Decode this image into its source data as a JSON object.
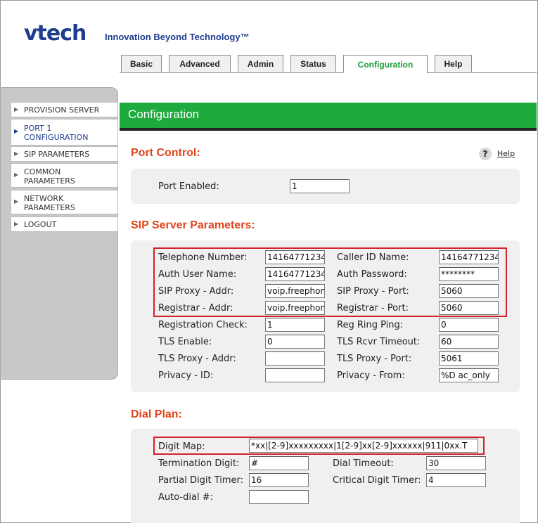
{
  "brand": {
    "logo": "vtech",
    "tagline": "Innovation Beyond Technology™"
  },
  "tabs": [
    {
      "label": "Basic"
    },
    {
      "label": "Advanced"
    },
    {
      "label": "Admin"
    },
    {
      "label": "Status"
    },
    {
      "label": "Configuration",
      "active": true
    },
    {
      "label": "Help"
    }
  ],
  "sidebar": {
    "items": [
      {
        "label": "PROVISION SERVER"
      },
      {
        "label": "PORT 1\nCONFIGURATION",
        "active": true
      },
      {
        "label": "SIP PARAMETERS"
      },
      {
        "label": "COMMON\nPARAMETERS"
      },
      {
        "label": "NETWORK\nPARAMETERS"
      },
      {
        "label": "LOGOUT"
      }
    ]
  },
  "header": {
    "title": "Configuration"
  },
  "help": {
    "icon_glyph": "?",
    "link": "Help"
  },
  "port_control": {
    "title": "Port Control:",
    "port_enabled_label": "Port Enabled:",
    "port_enabled_value": "1"
  },
  "sip_server": {
    "title": "SIP Server Parameters:",
    "rows": [
      {
        "l1": "Telephone Number:",
        "v1": "14164771234",
        "l2": "Caller ID Name:",
        "v2": "14164771234"
      },
      {
        "l1": "Auth User Name:",
        "v1": "14164771234",
        "l2": "Auth Password:",
        "v2": "********"
      },
      {
        "l1": "SIP Proxy - Addr:",
        "v1": "voip.freephon",
        "l2": "SIP Proxy - Port:",
        "v2": "5060"
      },
      {
        "l1": "Registrar - Addr:",
        "v1": "voip.freephon",
        "l2": "Registrar - Port:",
        "v2": "5060"
      },
      {
        "l1": "Registration Check:",
        "v1": "1",
        "l2": "Reg Ring Ping:",
        "v2": "0"
      },
      {
        "l1": "TLS Enable:",
        "v1": "0",
        "l2": "TLS Rcvr Timeout:",
        "v2": "60"
      },
      {
        "l1": "TLS Proxy - Addr:",
        "v1": "",
        "l2": "TLS Proxy - Port:",
        "v2": "5061"
      },
      {
        "l1": "Privacy - ID:",
        "v1": "",
        "l2": "Privacy - From:",
        "v2": "%D ac_only"
      }
    ]
  },
  "dial_plan": {
    "title": "Dial Plan:",
    "digit_map_label": "Digit Map:",
    "digit_map_value": "*xx|[2-9]xxxxxxxxx|1[2-9]xx[2-9]xxxxxx|911|0xx.T",
    "termination_digit_label": "Termination Digit:",
    "termination_digit_value": "#",
    "dial_timeout_label": "Dial Timeout:",
    "dial_timeout_value": "30",
    "partial_timer_label": "Partial Digit Timer:",
    "partial_timer_value": "16",
    "critical_timer_label": "Critical Digit Timer:",
    "critical_timer_value": "4",
    "autodial_label": "Auto-dial #:",
    "autodial_value": ""
  },
  "colors": {
    "accent_green": "#1eaa3c",
    "section_title": "#e0451c",
    "highlight_red": "#d3222a",
    "brand_blue": "#1f3d8f"
  }
}
